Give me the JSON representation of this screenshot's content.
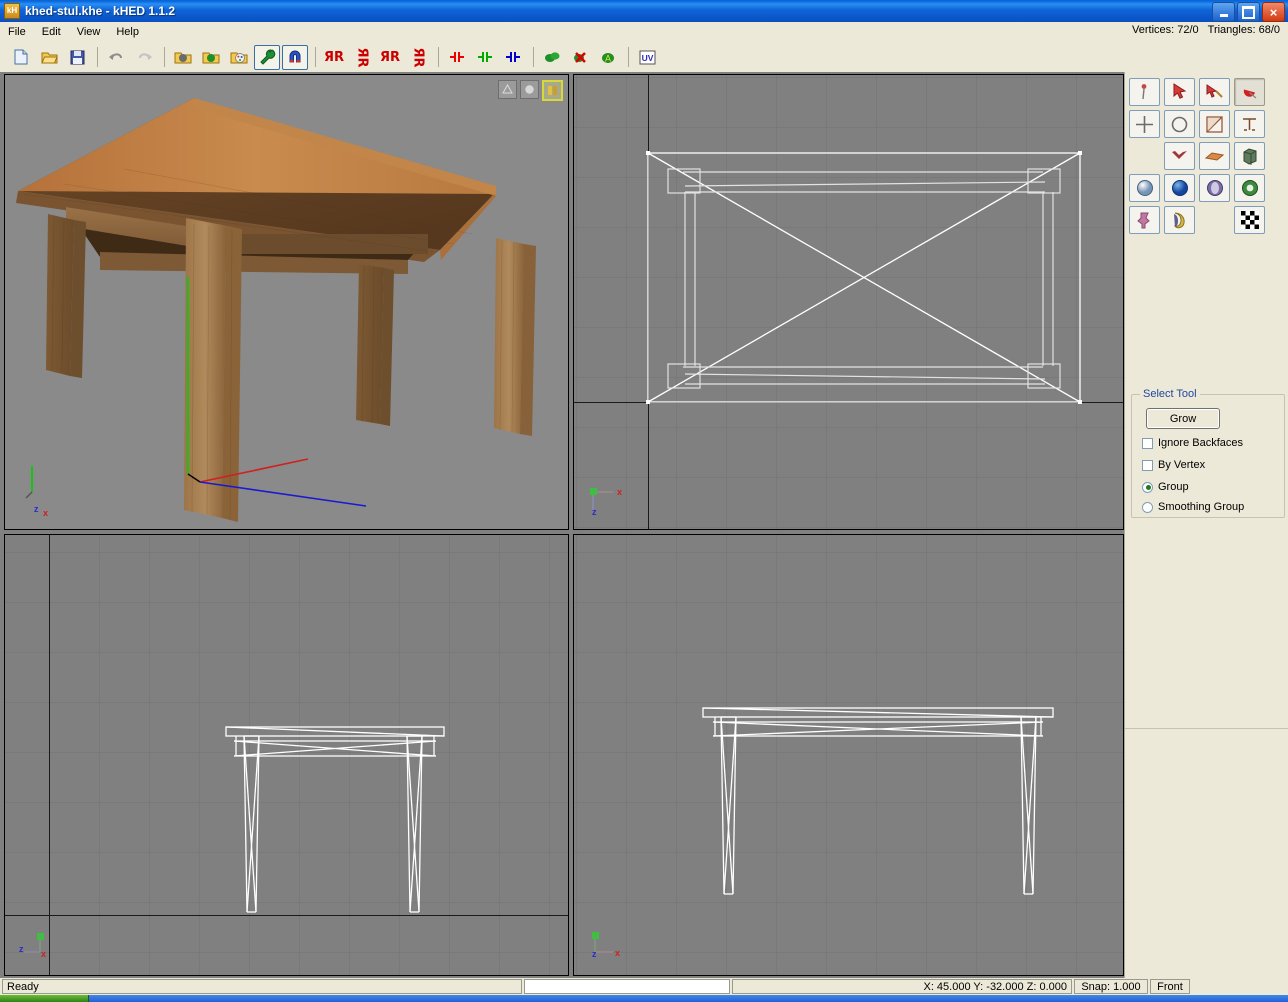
{
  "window": {
    "title": "khed-stul.khe - kHED 1.1.2",
    "app_icon_label": "kH",
    "controls": {
      "minimize": "_",
      "maximize": "❐",
      "close": "×"
    }
  },
  "menu": {
    "items": [
      "File",
      "Edit",
      "View",
      "Help"
    ]
  },
  "stats": {
    "vertices": "Vertices: 72/0",
    "triangles": "Triangles: 68/0"
  },
  "toolbar": {
    "groups": [
      {
        "buttons": [
          {
            "name": "new-file-icon",
            "glyph": "⬜",
            "title": "New",
            "active": false
          },
          {
            "name": "open-file-icon",
            "glyph": "📂",
            "title": "Open",
            "active": false
          },
          {
            "name": "save-file-icon",
            "glyph": "💾",
            "title": "Save",
            "active": false
          }
        ]
      },
      {
        "buttons": [
          {
            "name": "undo-icon",
            "glyph": "↶",
            "title": "Undo",
            "active": false
          },
          {
            "name": "redo-icon",
            "glyph": "↷",
            "title": "Redo",
            "active": false
          }
        ]
      },
      {
        "buttons": [
          {
            "name": "import-object-icon",
            "glyph": "📁",
            "title": "Import Object",
            "active": false
          },
          {
            "name": "import-mesh-icon",
            "glyph": "📁",
            "title": "Import Mesh",
            "active": false
          },
          {
            "name": "import-texture-icon",
            "glyph": "📁",
            "title": "Import Texture",
            "active": false
          },
          {
            "name": "tools-wrench-icon",
            "glyph": "🔧",
            "title": "Tools",
            "active": true
          },
          {
            "name": "magnet-snap-icon",
            "glyph": "🧲",
            "title": "Snap",
            "active": true
          }
        ]
      },
      {
        "buttons": [
          {
            "name": "mirror-x-icon",
            "glyph": "ЯR",
            "title": "Mirror X",
            "active": false
          },
          {
            "name": "mirror-y-icon",
            "glyph": "ЯR",
            "title": "Mirror Y",
            "active": false
          },
          {
            "name": "flip-x-icon",
            "glyph": "ЯR",
            "title": "Flip X",
            "active": false
          },
          {
            "name": "flip-y-icon",
            "glyph": "ЯR",
            "title": "Flip Y",
            "active": false
          }
        ]
      },
      {
        "buttons": [
          {
            "name": "weld-left-icon",
            "glyph": "┳",
            "title": "Weld Left",
            "active": false
          },
          {
            "name": "weld-center-icon",
            "glyph": "┳",
            "title": "Weld Center",
            "active": false
          },
          {
            "name": "weld-right-icon",
            "glyph": "┳",
            "title": "Weld Right",
            "active": false
          }
        ]
      },
      {
        "buttons": [
          {
            "name": "material-green-icon",
            "glyph": "●",
            "title": "Material",
            "active": false
          },
          {
            "name": "delete-material-icon",
            "glyph": "✖",
            "title": "Delete Material",
            "active": false
          },
          {
            "name": "assign-material-icon",
            "glyph": "A",
            "title": "Assign Material",
            "active": false
          }
        ]
      },
      {
        "buttons": [
          {
            "name": "uv-editor-icon",
            "glyph": "UV",
            "title": "UV Editor",
            "active": false
          }
        ]
      }
    ]
  },
  "viewports": [
    {
      "id": "perspective",
      "name": "viewport-perspective",
      "render_mode": "textured",
      "selected": true,
      "gizmo": {
        "axes": [
          "z",
          "x"
        ],
        "x_color": "#cc2222",
        "y_color": "#22aa22",
        "z_color": "#2222cc"
      },
      "overlay_buttons": [
        {
          "name": "wireframe-mode-icon",
          "glyph": "▦",
          "highlighted": false
        },
        {
          "name": "shaded-mode-icon",
          "glyph": "●",
          "highlighted": false
        },
        {
          "name": "textured-mode-icon",
          "glyph": "▨",
          "highlighted": true
        }
      ]
    },
    {
      "id": "top",
      "name": "viewport-top",
      "render_mode": "wireframe",
      "selected": false,
      "gizmo": {
        "axes": [
          "x",
          "z"
        ]
      }
    },
    {
      "id": "left",
      "name": "viewport-left",
      "render_mode": "wireframe",
      "selected": false,
      "gizmo": {
        "axes": [
          "z",
          "x"
        ]
      }
    },
    {
      "id": "front",
      "name": "viewport-front",
      "render_mode": "wireframe",
      "selected": false,
      "gizmo": {
        "axes": [
          "z",
          "x"
        ]
      }
    }
  ],
  "right_panel": {
    "tool_buttons": [
      [
        {
          "name": "pick-point-tool-icon",
          "glyph": "•",
          "pressed": false
        },
        {
          "name": "select-tool-icon",
          "glyph": "➤",
          "pressed": false
        },
        {
          "name": "select-add-tool-icon",
          "glyph": "➤",
          "pressed": false
        },
        {
          "name": "select-region-tool-icon",
          "glyph": "◕",
          "pressed": true
        }
      ],
      [
        {
          "name": "move-tool-icon",
          "glyph": "✚",
          "pressed": false
        },
        {
          "name": "rotate-tool-icon",
          "glyph": "◯",
          "pressed": false
        },
        {
          "name": "scale-tool-icon",
          "glyph": "◰",
          "pressed": false
        },
        {
          "name": "pivot-tool-icon",
          "glyph": "┴",
          "pressed": false
        }
      ],
      [
        {
          "name": "spacer",
          "glyph": "",
          "pressed": false,
          "placeholder": true
        },
        {
          "name": "vertex-mode-icon",
          "glyph": "▾",
          "pressed": false
        },
        {
          "name": "face-mode-icon",
          "glyph": "◆",
          "pressed": false
        },
        {
          "name": "object-mode-icon",
          "glyph": "■",
          "pressed": false
        }
      ],
      [
        {
          "name": "create-sphere-icon",
          "glyph": "●",
          "pressed": false
        },
        {
          "name": "create-ball-icon",
          "glyph": "●",
          "pressed": false
        },
        {
          "name": "create-hemisphere-icon",
          "glyph": "◕",
          "pressed": false
        },
        {
          "name": "create-torus-icon",
          "glyph": "◎",
          "pressed": false
        }
      ],
      [
        {
          "name": "create-lathe-icon",
          "glyph": "♗",
          "pressed": false
        },
        {
          "name": "create-extrude-icon",
          "glyph": "◗",
          "pressed": false
        },
        {
          "name": "spacer2",
          "glyph": "",
          "pressed": false,
          "placeholder": true
        },
        {
          "name": "checker-texture-icon",
          "glyph": "▦",
          "pressed": false
        }
      ]
    ],
    "select_tool": {
      "title": "Select Tool",
      "grow_label": "Grow",
      "checkboxes": [
        {
          "label": "Ignore Backfaces",
          "checked": false
        },
        {
          "label": "By Vertex",
          "checked": false
        }
      ],
      "radios": [
        {
          "label": "Group",
          "checked": true
        },
        {
          "label": "Smoothing Group",
          "checked": false
        }
      ]
    }
  },
  "statusbar": {
    "ready": "Ready",
    "input_value": "",
    "coordinates": "X: 45.000 Y: -32.000 Z: 0.000",
    "snap": "Snap: 1.000",
    "view": "Front"
  },
  "colors": {
    "titlebar_blue": "#0a61d6",
    "panel_beige": "#ece9d8",
    "viewport_grey": "#808080",
    "wireframe_white": "#ffffff",
    "accent_link": "#21489e"
  }
}
